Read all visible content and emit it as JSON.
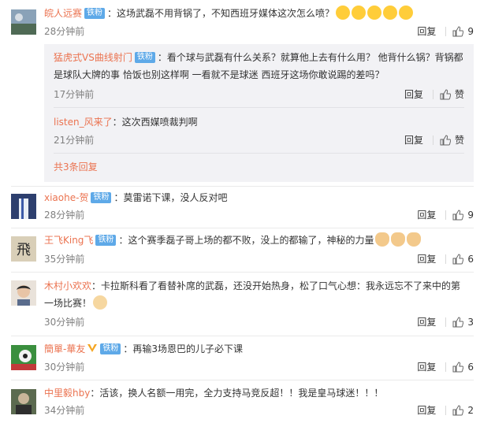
{
  "comments": [
    {
      "name": "皖人远赛",
      "badge": "铁粉",
      "text": "：这场武磊不用背锅了，不知西班牙媒体这次怎么喷？",
      "emoji_count": 5,
      "time": "28分钟前",
      "reply": "回复",
      "likes": "9"
    },
    {
      "name": "xiaohe-贺",
      "badge": "铁粉",
      "text": "：莫雷诺下课，没人反对吧",
      "time": "28分钟前",
      "reply": "回复",
      "likes": "9"
    },
    {
      "name": "王飞King飞",
      "badge": "铁粉",
      "text": "：这个赛季磊子哥上场的都不败，没上的都输了，神秘的力量",
      "time": "35分钟前",
      "reply": "回复",
      "likes": "6"
    },
    {
      "name": "木村小欢欢",
      "text": "：卡拉斯科看了看替补席的武磊，还没开始热身，松了口气心想：我永远忘不了来中的第一场比赛！",
      "time": "30分钟前",
      "reply": "回复",
      "likes": "3"
    },
    {
      "name": "簡單-華友",
      "badge": "铁粉",
      "text": "：再输3场恩巴的儿子必下课",
      "time": "30分钟前",
      "reply": "回复",
      "likes": "6"
    },
    {
      "name": "中里毅hby",
      "text": "：活该，换人名额一用完，全力支持马竞反超！！我是皇马球迷！！！",
      "time": "34分钟前",
      "reply": "回复",
      "likes": "2"
    }
  ],
  "replies": [
    {
      "name": "猛虎式VS曲线射门",
      "badge": "铁粉",
      "text": "：看个球与武磊有什么关系？就算他上去有什么用？ 他背什么锅？背锅都是球队大牌的事 恰饭也别这样啊 一看就不是球迷 西班牙这场你敢说踢的差吗？",
      "time": "17分钟前",
      "reply": "回复",
      "like": "赞"
    },
    {
      "name": "listen_风来了",
      "text": "：这次西媒喷裁判啊",
      "time": "21分钟前",
      "reply": "回复",
      "like": "赞"
    }
  ],
  "more_replies": "共3条回复",
  "colors": {
    "name": "#eb7350",
    "badge": "#5ea9e8",
    "time": "#808080",
    "reply_box": "#f2f2f5"
  }
}
